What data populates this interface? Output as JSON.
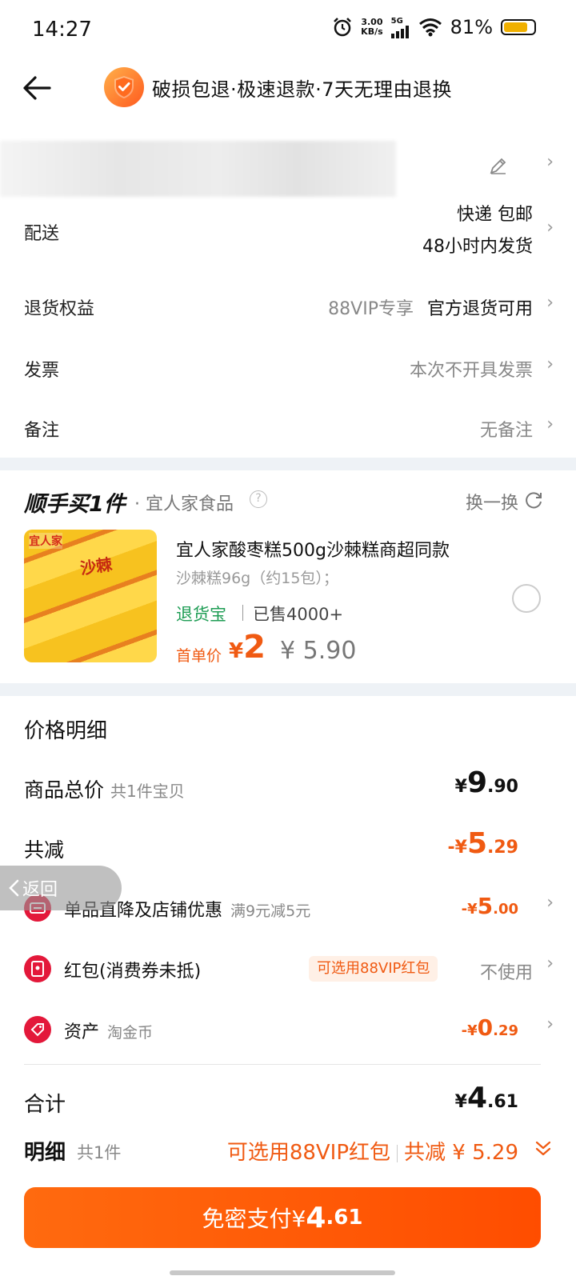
{
  "status_bar": {
    "time": "14:27",
    "net_speed_value": "3.00",
    "net_speed_unit": "KB/s",
    "network": "5G",
    "battery": "81%",
    "battery_level": 0.81
  },
  "header": {
    "title": "破损包退·极速退款·7天无理由退换"
  },
  "delivery": {
    "label": "配送",
    "method": "快递 包邮",
    "ship_time": "48小时内发货"
  },
  "returns": {
    "label": "退货权益",
    "vip_note": "88VIP专享",
    "value": "官方退货可用"
  },
  "invoice": {
    "label": "发票",
    "value": "本次不开具发票"
  },
  "remark": {
    "label": "备注",
    "value": "无备注"
  },
  "addon": {
    "title": "顺手买1件",
    "shop": "· 宜人家食品",
    "swap": "换一换",
    "product": {
      "image_brand": "宜人家",
      "image_tag": "沙棘",
      "name": "宜人家酸枣糕500g沙棘糕商超同款",
      "spec": "沙棘糕96g（约15包）；",
      "badge": "退货宝",
      "sold": "已售4000+",
      "first_price_label": "首单价",
      "first_price_symbol": "¥",
      "first_price": "2",
      "original_price": "¥ 5.90"
    }
  },
  "price_detail": {
    "title": "价格明细",
    "goods_total": {
      "label": "商品总价",
      "sub": "共1件宝贝",
      "yen": "¥",
      "int": "9",
      "dec": ".90"
    },
    "total_discount": {
      "label": "共减",
      "yen": "-¥",
      "int": "5",
      "dec": ".29"
    },
    "items": [
      {
        "label": "单品直降及店铺优惠",
        "note": "满9元减5元",
        "yen": "-¥",
        "int": "5",
        "dec": ".00",
        "icon": "coupon-icon"
      },
      {
        "label": "红包(消费券未抵)",
        "tag": "可选用88VIP红包",
        "value": "不使用",
        "icon": "red-packet-icon"
      },
      {
        "label": "资产",
        "note": "淘金币",
        "yen": "-¥",
        "int": "0",
        "dec": ".29",
        "icon": "gold-coin-icon"
      }
    ],
    "total": {
      "label": "合计",
      "yen": "¥",
      "int": "4",
      "dec": ".61"
    },
    "detail": {
      "label": "明细",
      "count": "共1件",
      "vip": "可选用88VIP红包",
      "discount": "共减 ¥ 5.29"
    }
  },
  "pay_button": {
    "label": "免密支付¥",
    "int": "4",
    "dec": ".61"
  },
  "float_back": {
    "label": "返回"
  },
  "colors": {
    "accent": "#f05a12",
    "pay_button": "#ff5a0a",
    "badge_green": "#1f9d55",
    "icon_red": "#e3183a"
  }
}
